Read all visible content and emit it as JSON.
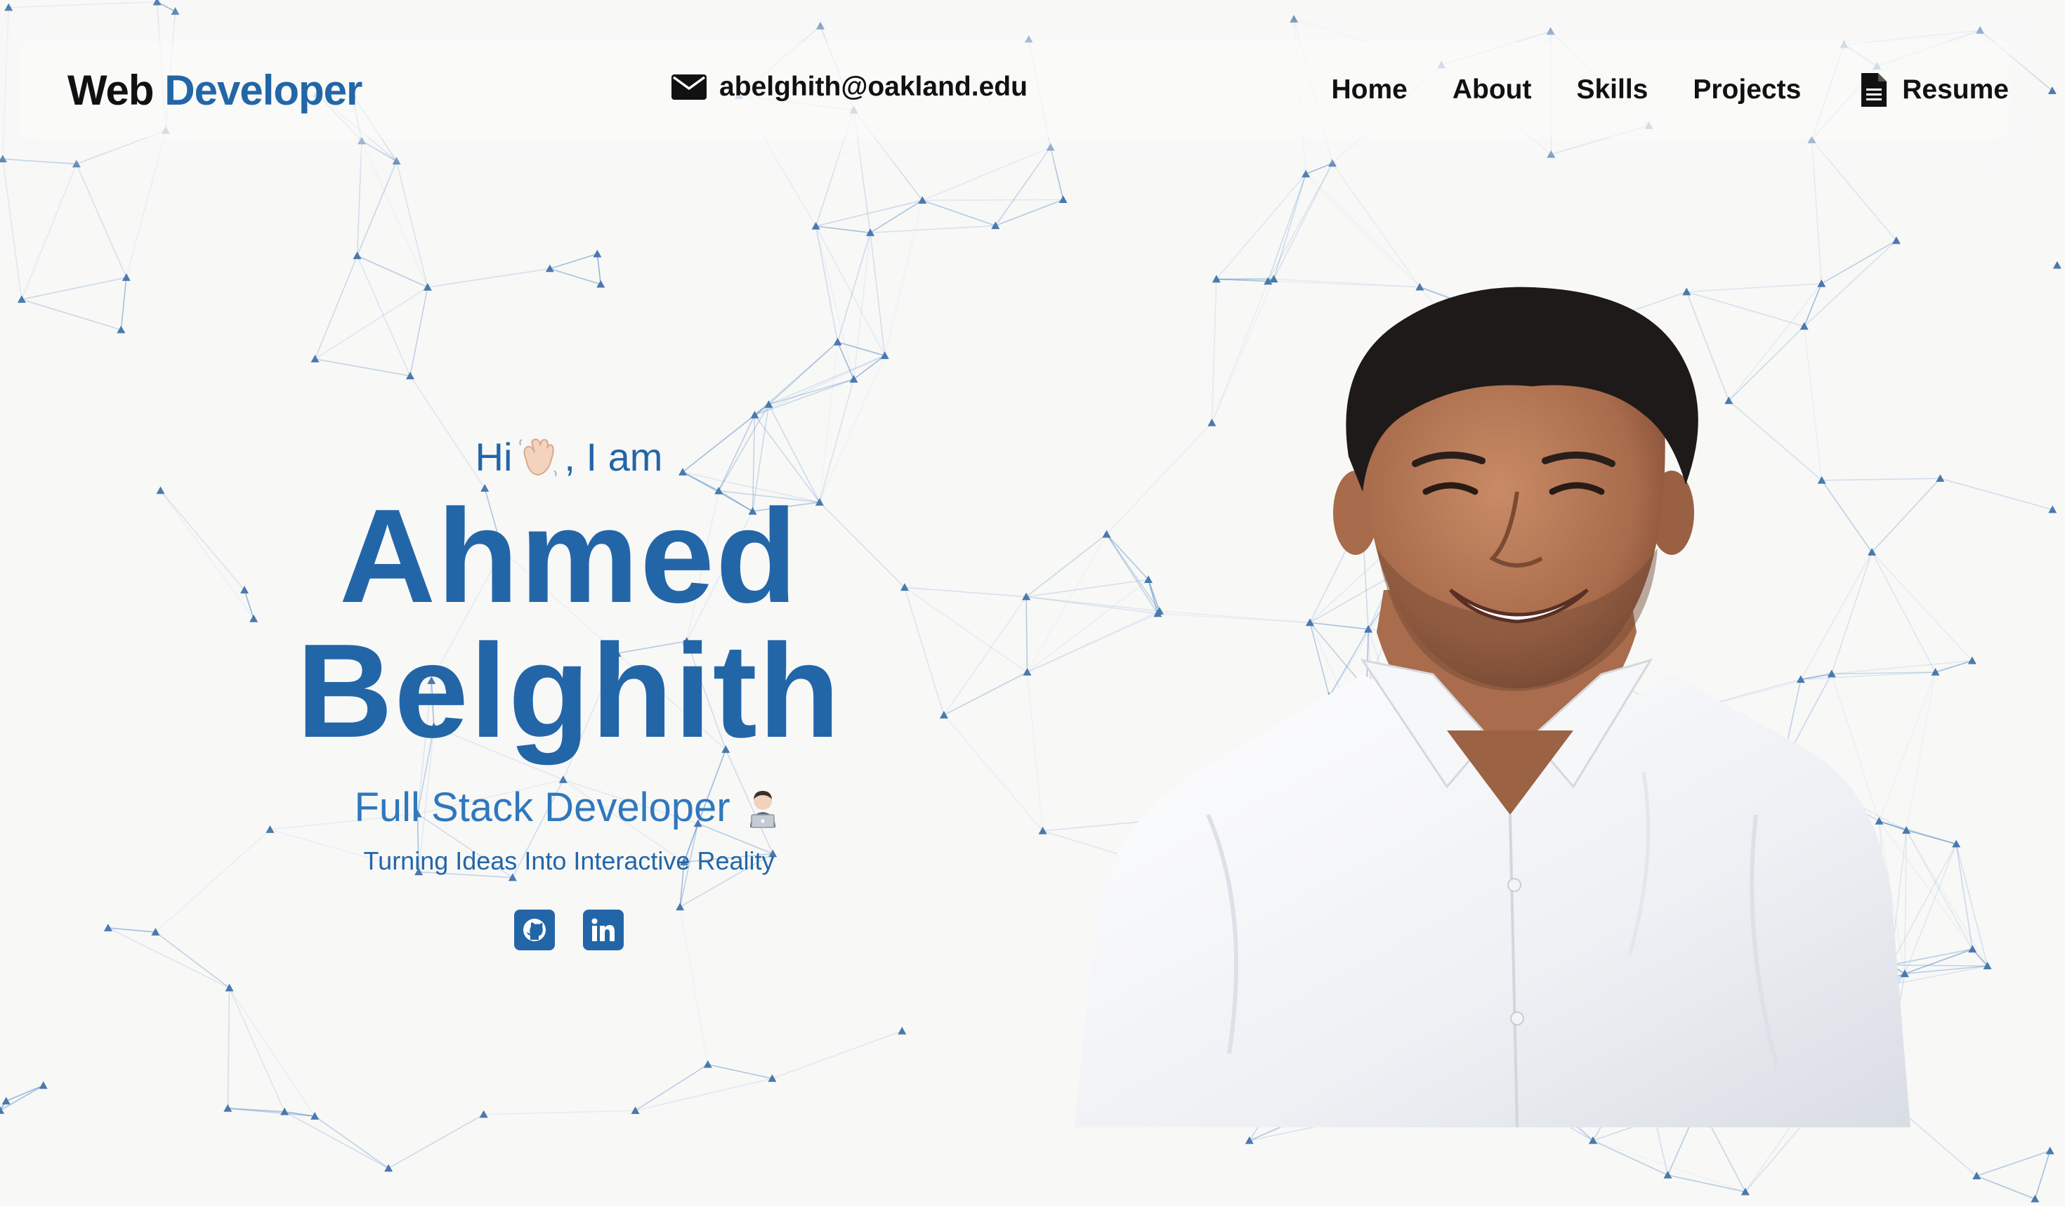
{
  "nav": {
    "brand_first": "Web",
    "brand_second": "Developer",
    "email": "abelghith@oakland.edu",
    "links": [
      "Home",
      "About",
      "Skills",
      "Projects"
    ],
    "resume_label": "Resume"
  },
  "hero": {
    "greeting_hi": "Hi",
    "greeting_rest": ", I am",
    "first_name": "Ahmed",
    "last_name": "Belghith",
    "role": "Full Stack Developer",
    "tagline": "Turning Ideas Into Interactive Reality",
    "socials": [
      "github-icon",
      "linkedin-icon"
    ]
  },
  "colors": {
    "accent": "#2366a8",
    "accent_light": "#2f78bd",
    "background": "#f8f8f7",
    "network": "#5b8fc7"
  }
}
